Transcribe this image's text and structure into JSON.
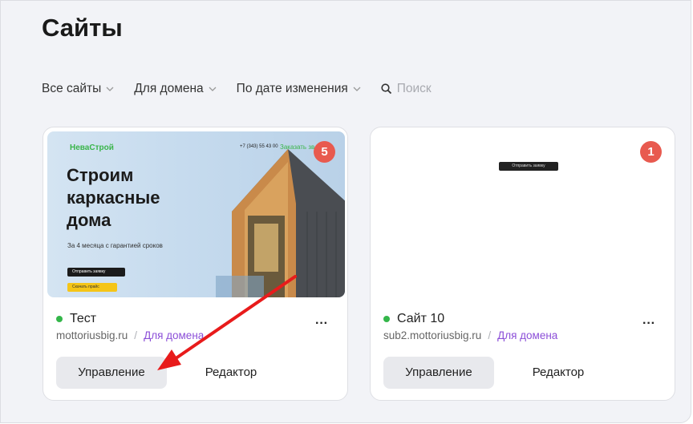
{
  "page": {
    "title": "Сайты"
  },
  "filters": {
    "all_sites": "Все сайты",
    "for_domain": "Для домена",
    "sort": "По дате изменения",
    "search_placeholder": "Поиск"
  },
  "sites": [
    {
      "badge": "5",
      "name": "Тест",
      "domain": "mottoriusbig.ru",
      "domain_link": "Для домена",
      "manage_label": "Управление",
      "editor_label": "Редактор",
      "status_color": "#34b64a",
      "thumbnail": {
        "logo": "НеваСтрой",
        "phone": "+7 (343) 55 43 00",
        "order": "Заказать зв",
        "headline_1": "Строим",
        "headline_2": "каркасные",
        "headline_3": "дома",
        "subline": "За 4 месяца с гарантией сроков",
        "btn_primary": "Отправить заявку",
        "btn_secondary": "Скачать прайс"
      }
    },
    {
      "badge": "1",
      "name": "Сайт 10",
      "domain": "sub2.mottoriusbig.ru",
      "domain_link": "Для домена",
      "manage_label": "Управление",
      "editor_label": "Редактор",
      "status_color": "#34b64a",
      "thumbnail": {
        "snippet": "Отправить заявку"
      }
    }
  ],
  "colors": {
    "badge": "#e85a4f",
    "link": "#8c4fd8",
    "arrow": "#e81b1b"
  }
}
